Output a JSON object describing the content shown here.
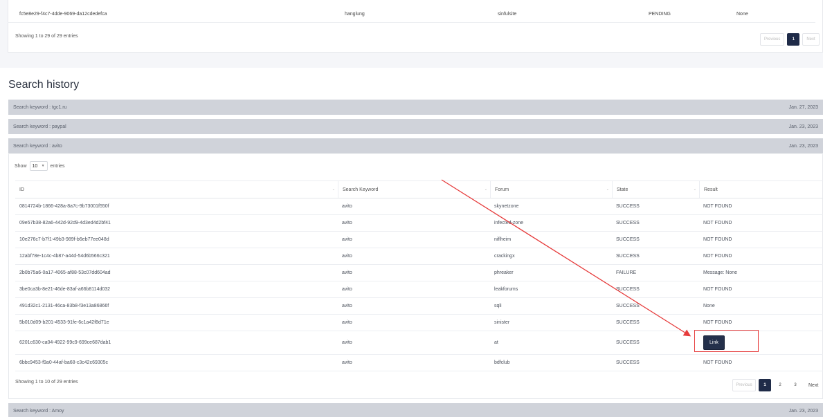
{
  "top_table": {
    "row": {
      "id": "fc5e8e29-f4c7-4dde-9069-da12cdedefca",
      "keyword": "hanglung",
      "forum": "sinfulsite",
      "state": "PENDING",
      "result": "None"
    },
    "showing": "Showing 1 to 29 of 29 entries",
    "pager": {
      "previous": "Previous",
      "page": "1",
      "next": "Next"
    }
  },
  "history": {
    "title": "Search history",
    "keywords": [
      {
        "label": "Search keyword : tgc1.ru",
        "date": "Jan. 27, 2023"
      },
      {
        "label": "Search keyword : paypal",
        "date": "Jan. 23, 2023"
      },
      {
        "label": "Search keyword : avito",
        "date": "Jan. 23, 2023"
      },
      {
        "label": "Search keyword : Amoy",
        "date": "Jan. 23, 2023"
      }
    ],
    "show": {
      "prefix": "Show",
      "value": "10",
      "suffix": "entries"
    },
    "columns": [
      "ID",
      "Search Keyword",
      "Forum",
      "State",
      "Result"
    ],
    "rows": [
      {
        "id": "0814724b-1866-428a-8a7c-9b73001f550f",
        "kw": "avito",
        "forum": "skynetzone",
        "state": "SUCCESS",
        "result": "NOT FOUND"
      },
      {
        "id": "09e57b38-82a6-442d-92d9-4d3ed4d2bf41",
        "kw": "avito",
        "forum": "infected-zone",
        "state": "SUCCESS",
        "result": "NOT FOUND"
      },
      {
        "id": "10e276c7-b7f1-49b3-989f-b6eb77ee048d",
        "kw": "avito",
        "forum": "niflheim",
        "state": "SUCCESS",
        "result": "NOT FOUND"
      },
      {
        "id": "12abf78e-1c4c-4b87-a44d-54d6b566c321",
        "kw": "avito",
        "forum": "crackingx",
        "state": "SUCCESS",
        "result": "NOT FOUND"
      },
      {
        "id": "2b0b75a6-0a17-4065-af88-53c07dd604ad",
        "kw": "avito",
        "forum": "phreaker",
        "state": "FAILURE",
        "result": "Message: None"
      },
      {
        "id": "3be0ca3b-8e21-46de-83af-a66b8114d032",
        "kw": "avito",
        "forum": "leakforums",
        "state": "SUCCESS",
        "result": "NOT FOUND"
      },
      {
        "id": "491d32c1-2131-46ca-83b8-f3e13a86866f",
        "kw": "avito",
        "forum": "sqli",
        "state": "SUCCESS",
        "result": "None"
      },
      {
        "id": "5b010d09-b201-4533-91fe-6c1a42f8d71e",
        "kw": "avito",
        "forum": "sinister",
        "state": "SUCCESS",
        "result": "NOT FOUND"
      },
      {
        "id": "6201c630-ca04-4922-99c9-699ce687dab1",
        "kw": "avito",
        "forum": "at",
        "state": "SUCCESS",
        "result": "Link",
        "is_link": true
      },
      {
        "id": "6bbc9453-f9a0-44af-ba68-c3c42c69305c",
        "kw": "avito",
        "forum": "bdfclub",
        "state": "SUCCESS",
        "result": "NOT FOUND"
      }
    ],
    "showing": "Showing 1 to 10 of 29 entries",
    "pager": {
      "previous": "Previous",
      "pages": [
        "1",
        "2",
        "3"
      ],
      "next": "Next"
    }
  },
  "colors": {
    "accent": "#1f2b48",
    "annotation": "#e63b3b",
    "bar": "#d0d3da"
  }
}
